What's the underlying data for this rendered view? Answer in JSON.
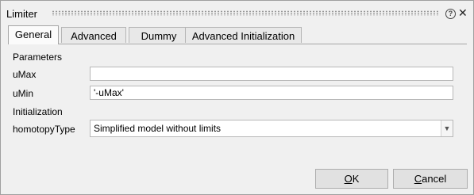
{
  "window": {
    "title": "Limiter"
  },
  "tabs": [
    {
      "label": "General",
      "active": true
    },
    {
      "label": "Advanced",
      "active": false
    },
    {
      "label": "Dummy",
      "active": false
    },
    {
      "label": "Advanced Initialization",
      "active": false
    }
  ],
  "general": {
    "parameters_heading": "Parameters",
    "umax": {
      "label": "uMax",
      "value": ""
    },
    "umin": {
      "label": "uMin",
      "value": "'-uMax'"
    },
    "initialization_heading": "Initialization",
    "homotopy": {
      "label": "homotopyType",
      "value": "Simplified model without limits"
    }
  },
  "buttons": {
    "ok_mnemonic": "O",
    "ok_rest": "K",
    "cancel_mnemonic": "C",
    "cancel_rest": "ancel"
  },
  "icons": {
    "help": "help-icon",
    "close": "close-icon",
    "dropdown": "chevron-down-icon"
  }
}
